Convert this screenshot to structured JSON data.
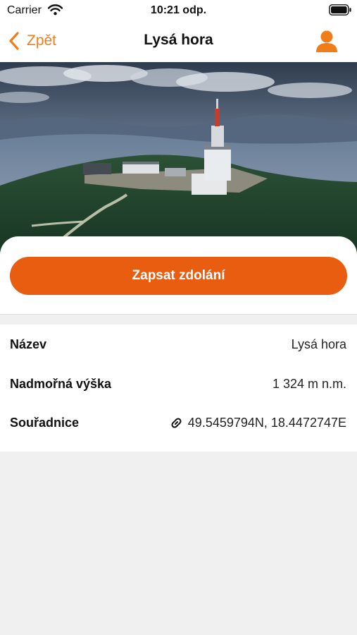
{
  "status_bar": {
    "carrier": "Carrier",
    "time": "10:21 odp.",
    "wifi_icon": "wifi-icon",
    "battery_icon": "battery-icon"
  },
  "nav": {
    "back_label": "Zpět",
    "title": "Lysá hora",
    "back_icon": "chevron-left-icon",
    "profile_icon": "person-icon"
  },
  "hero": {
    "image": "photo-of-mountain-summit-with-transmitter-tower"
  },
  "actions": {
    "record_label": "Zapsat zdolání"
  },
  "details": {
    "rows": [
      {
        "label": "Název",
        "value": "Lysá hora"
      },
      {
        "label": "Nadmořná výška",
        "value": "1 324 m n.m."
      },
      {
        "label": "Souřadnice",
        "value": "49.5459794N, 18.4472747E",
        "icon": "link-icon"
      }
    ]
  },
  "colors": {
    "accent": "#ef7d1a",
    "button": "#e85d0f",
    "background": "#f0f0f0",
    "surface": "#ffffff"
  }
}
